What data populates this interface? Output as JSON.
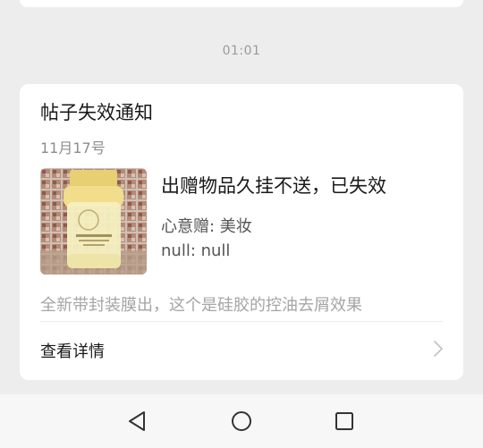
{
  "timestamp": "01:01",
  "notice": {
    "title": "帖子失效通知",
    "date": "11月17号",
    "item_title": "出赠物品久挂不送，已失效",
    "info_line1": "心意赠: 美妆",
    "info_line2": "null: null",
    "description": "全新带封装膜出，这个是硅胶的控油去屑效果",
    "details_label": "查看详情",
    "thumbnail": "product-photo"
  },
  "navbar": {
    "back": "back-triangle-icon",
    "home": "home-circle-icon",
    "recent": "recent-apps-square-icon"
  }
}
